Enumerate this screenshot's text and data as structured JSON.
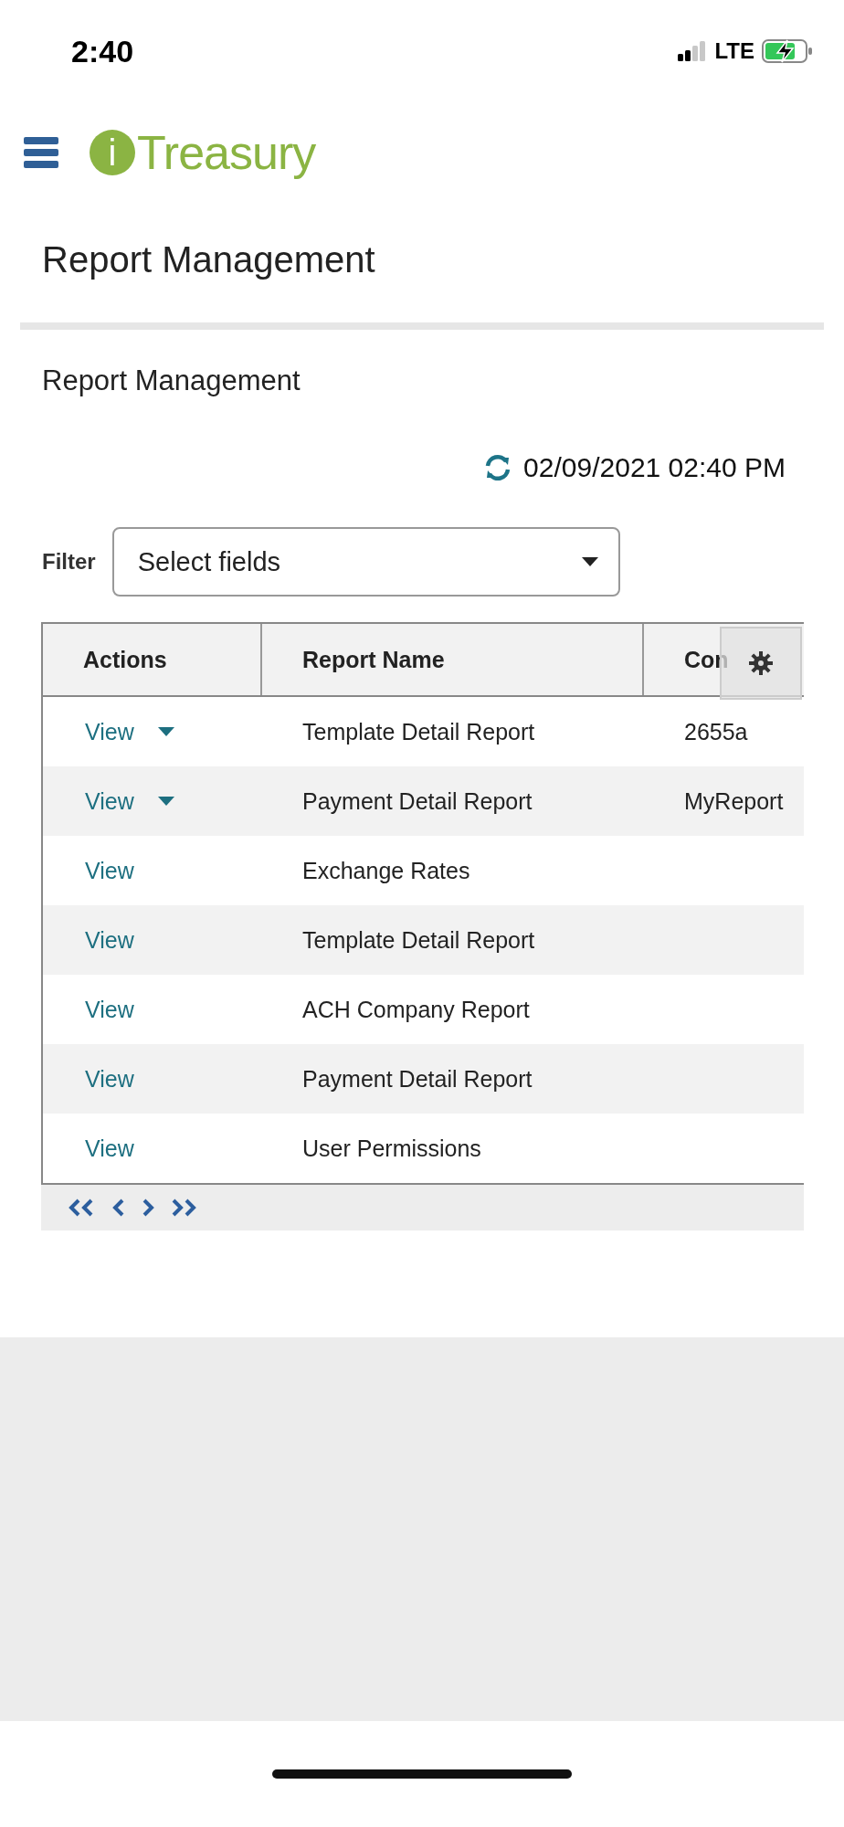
{
  "status_bar": {
    "time": "2:40",
    "network": "LTE"
  },
  "header": {
    "logo_mark": "i",
    "logo_text": "Treasury"
  },
  "page_title": "Report Management",
  "section": {
    "title": "Report Management",
    "refreshed": "02/09/2021 02:40 PM",
    "filter": {
      "label": "Filter",
      "placeholder": "Select fields"
    },
    "table": {
      "columns": [
        "Actions",
        "Report Name",
        "Con"
      ],
      "rows": [
        {
          "action": "View",
          "has_menu": true,
          "report_name": "Template Detail Report",
          "configuration": "2655a"
        },
        {
          "action": "View",
          "has_menu": true,
          "report_name": "Payment Detail Report",
          "configuration": "MyReport"
        },
        {
          "action": "View",
          "has_menu": false,
          "report_name": "Exchange Rates"
        },
        {
          "action": "View",
          "has_menu": false,
          "report_name": "Template Detail Report"
        },
        {
          "action": "View",
          "has_menu": false,
          "report_name": "ACH Company Report"
        },
        {
          "action": "View",
          "has_menu": false,
          "report_name": "Payment Detail Report"
        },
        {
          "action": "View",
          "has_menu": false,
          "report_name": "User Permissions"
        }
      ]
    }
  }
}
